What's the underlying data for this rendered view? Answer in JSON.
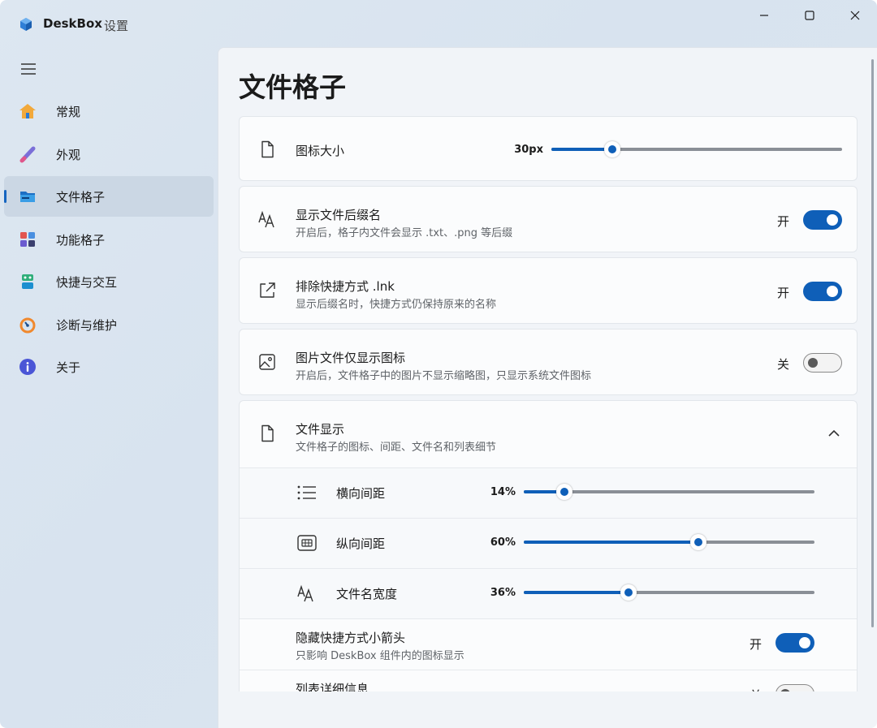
{
  "titlebar": {
    "app_name": "DeskBox",
    "subtitle": "设置"
  },
  "sidebar": {
    "items": [
      {
        "label": "常规"
      },
      {
        "label": "外观"
      },
      {
        "label": "文件格子"
      },
      {
        "label": "功能格子"
      },
      {
        "label": "快捷与交互"
      },
      {
        "label": "诊断与维护"
      },
      {
        "label": "关于"
      }
    ],
    "active_index": 2
  },
  "page": {
    "title": "文件格子"
  },
  "settings": {
    "icon_size": {
      "title": "图标大小",
      "value": "30px",
      "level": 0.21
    },
    "show_ext": {
      "title": "显示文件后缀名",
      "desc": "开启后，格子内文件会显示 .txt、.png 等后缀",
      "state": "开",
      "on": true
    },
    "exclude_lnk": {
      "title": "排除快捷方式 .lnk",
      "desc": "显示后缀名时，快捷方式仍保持原来的名称",
      "state": "开",
      "on": true
    },
    "image_icon_only": {
      "title": "图片文件仅显示图标",
      "desc": "开启后，文件格子中的图片不显示缩略图，只显示系统文件图标",
      "state": "关",
      "on": false
    },
    "file_display": {
      "title": "文件显示",
      "desc": "文件格子的图标、间距、文件名和列表细节",
      "rows": [
        {
          "label": "横向间距",
          "value": "14%",
          "level": 0.14
        },
        {
          "label": "纵向间距",
          "value": "60%",
          "level": 0.6
        },
        {
          "label": "文件名宽度",
          "value": "36%",
          "level": 0.36
        }
      ],
      "hide_arrow": {
        "title": "隐藏快捷方式小箭头",
        "desc": "只影响 DeskBox 组件内的图标显示",
        "state": "开",
        "on": true
      },
      "list_detail": {
        "title": "列表详细信息",
        "state": "关",
        "on": false
      }
    }
  },
  "colors": {
    "accent": "#0f5fb8",
    "sidebar_active": "#cbd7e4"
  }
}
